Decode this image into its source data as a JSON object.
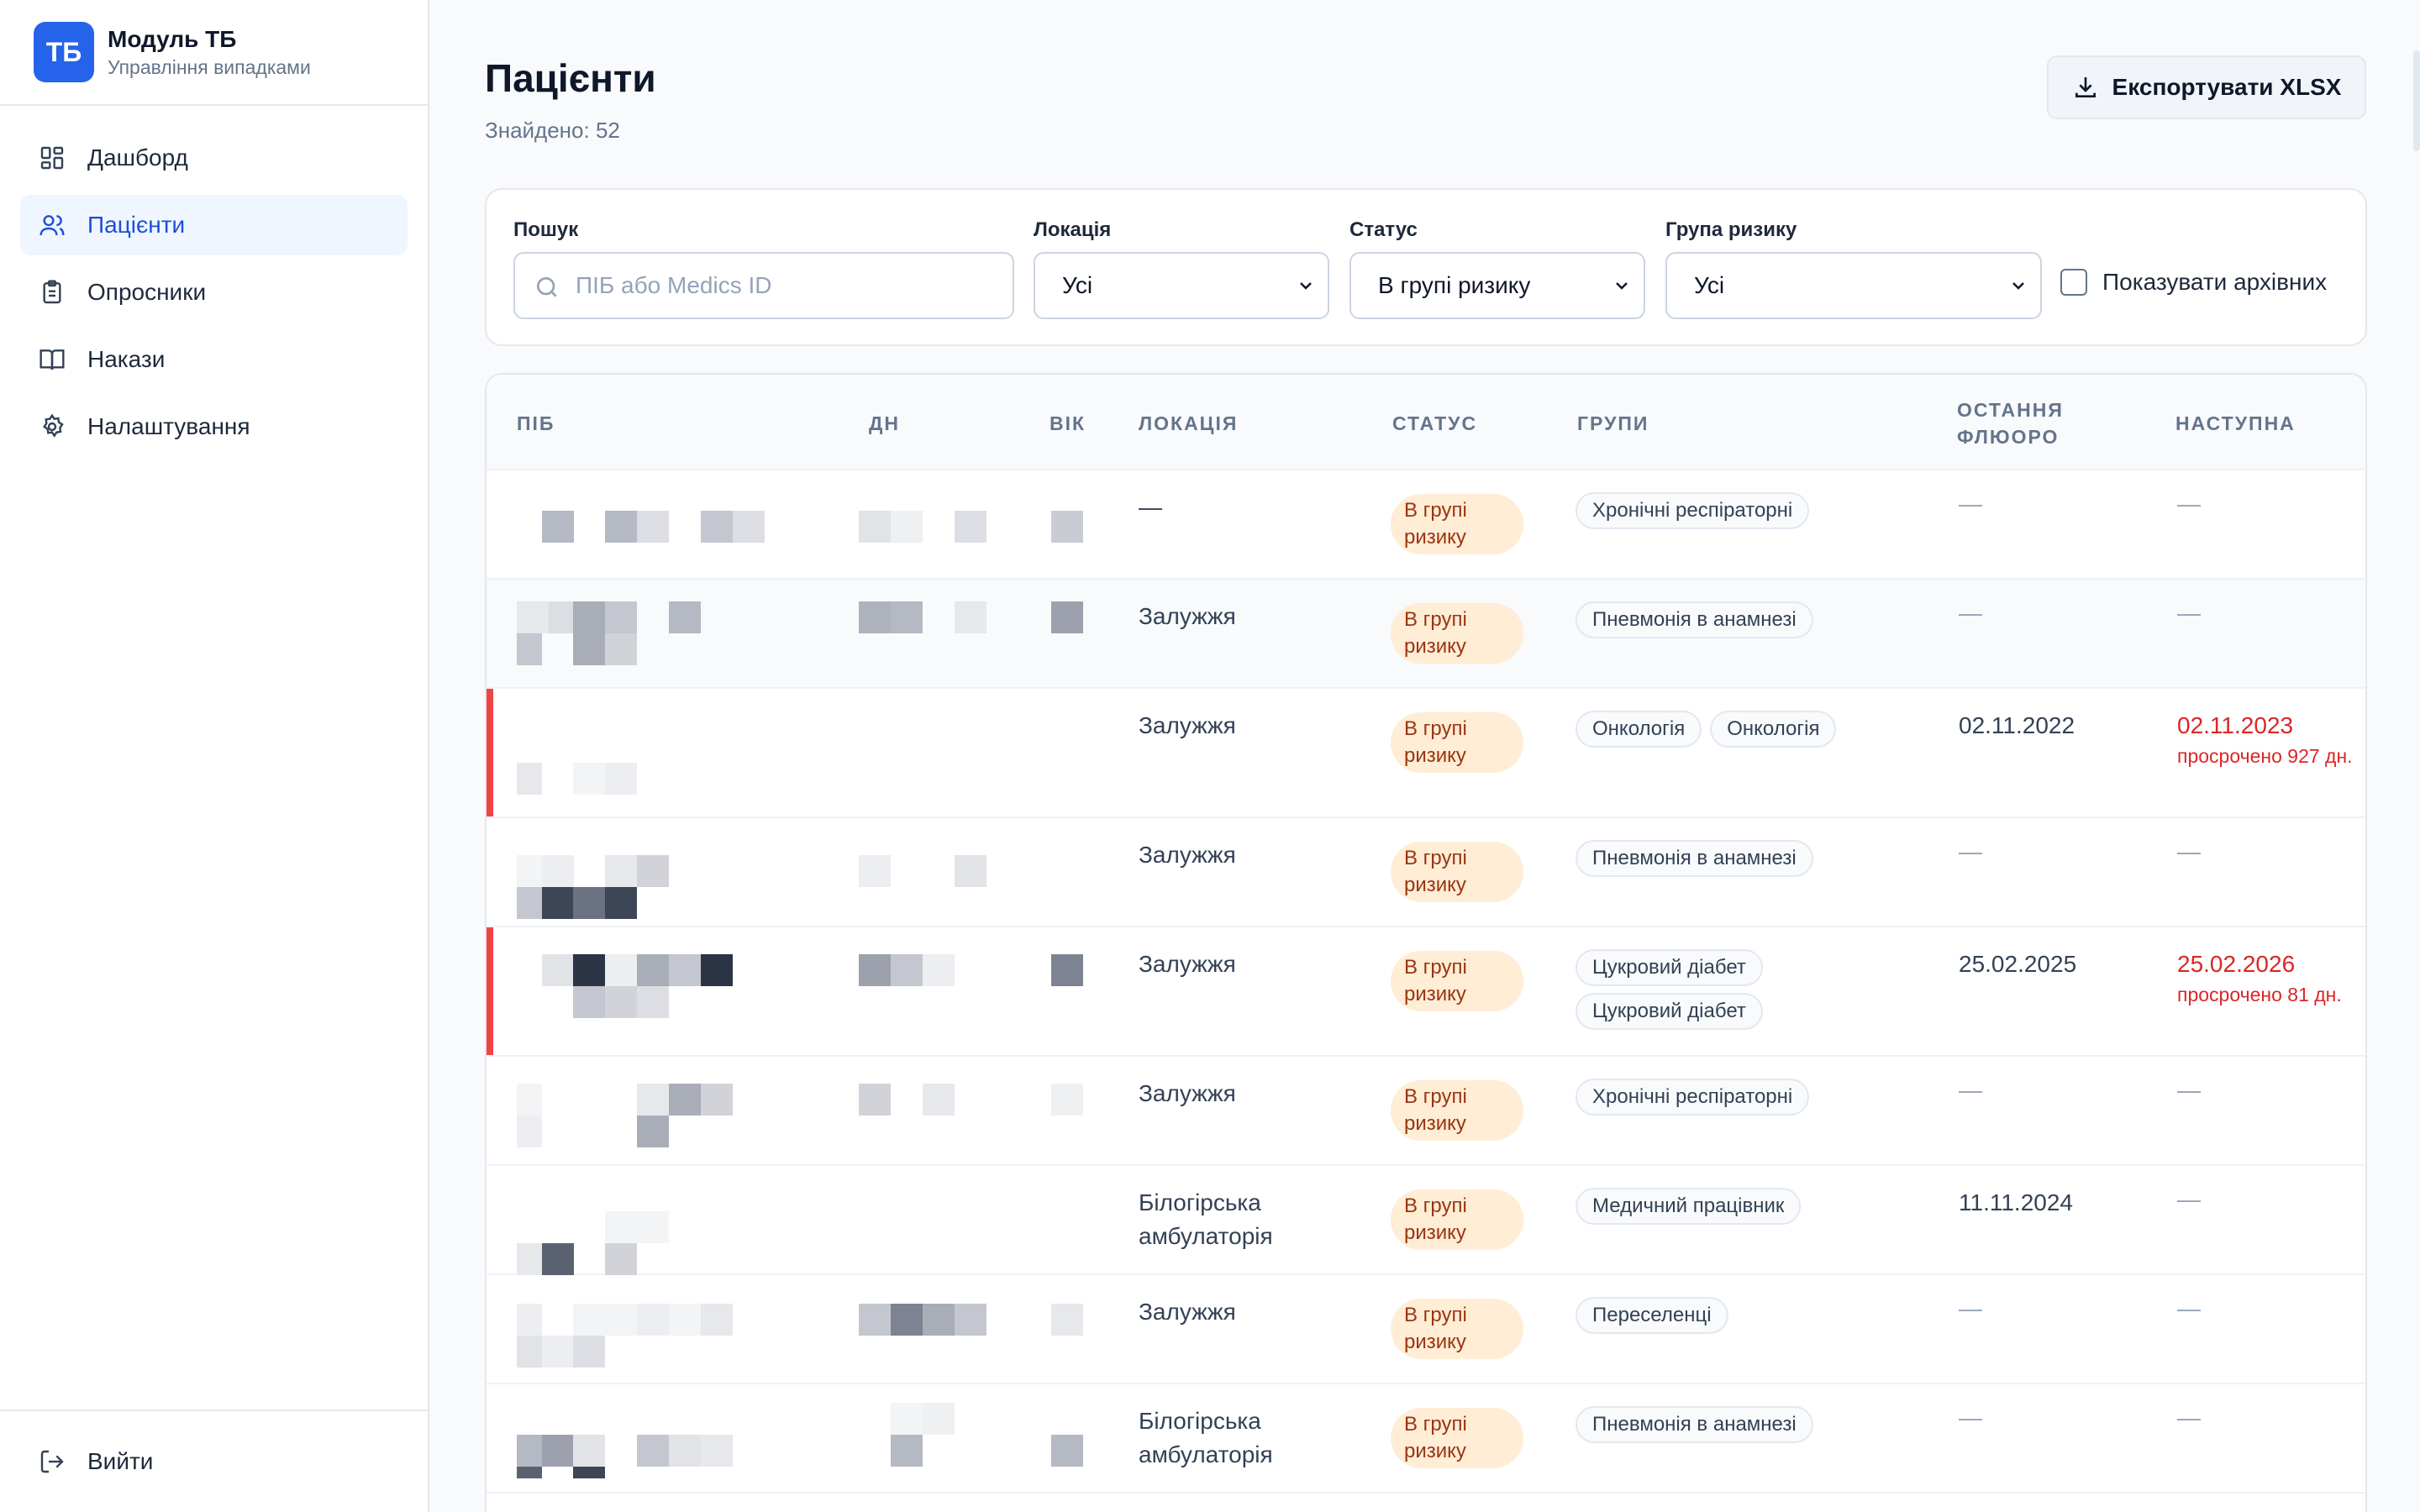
{
  "brand": {
    "logo": "ТБ",
    "title": "Модуль ТБ",
    "subtitle": "Управління випадками"
  },
  "nav": [
    {
      "label": "Дашборд",
      "icon": "dashboard-icon",
      "active": false
    },
    {
      "label": "Пацієнти",
      "icon": "users-icon",
      "active": true
    },
    {
      "label": "Опросники",
      "icon": "clipboard-icon",
      "active": false
    },
    {
      "label": "Накази",
      "icon": "book-icon",
      "active": false
    },
    {
      "label": "Налаштування",
      "icon": "gear-icon",
      "active": false
    }
  ],
  "logout": {
    "label": "Вийти",
    "icon": "logout-icon"
  },
  "page": {
    "title": "Пацієнти",
    "found": "Знайдено: 52",
    "export_label": "Експортувати XLSX"
  },
  "filters": {
    "search_label": "Пошук",
    "search_placeholder": "ПІБ або Medics ID",
    "location_label": "Локація",
    "location_value": "Усі",
    "status_label": "Статус",
    "status_value": "В групі ризику",
    "risk_label": "Група ризику",
    "risk_value": "Усі",
    "archive_label": "Показувати архівних",
    "archive_checked": false
  },
  "table": {
    "headers": {
      "name": "ПІБ",
      "dob": "ДН",
      "age": "ВІК",
      "location": "ЛОКАЦІЯ",
      "status": "СТАТУС",
      "groups": "ГРУПИ",
      "last_xray_1": "ОСТАННЯ",
      "last_xray_2": "ФЛЮОРО",
      "next": "НАСТУПНА"
    },
    "status_line1": "В групі",
    "status_line2": "ризику",
    "dash": "—",
    "rows": [
      {
        "location": "—",
        "groups": [
          "Хронічні респіраторні"
        ],
        "last": "—",
        "next": "—",
        "next_overdue": ""
      },
      {
        "location": "Залужжя",
        "groups": [
          "Пневмонія в анамнезі"
        ],
        "last": "—",
        "next": "—",
        "next_overdue": ""
      },
      {
        "location": "Залужжя",
        "groups": [
          "Онкологія",
          "Онкологія"
        ],
        "last": "02.11.2022",
        "next": "02.11.2023",
        "next_overdue": "просрочено 927 дн."
      },
      {
        "location": "Залужжя",
        "groups": [
          "Пневмонія в анамнезі"
        ],
        "last": "—",
        "next": "—",
        "next_overdue": ""
      },
      {
        "location": "Залужжя",
        "groups": [
          "Цукровий діабет",
          "Цукровий діабет"
        ],
        "last": "25.02.2025",
        "next": "25.02.2026",
        "next_overdue": "просрочено 81 дн."
      },
      {
        "location": "Залужжя",
        "groups": [
          "Хронічні респіраторні"
        ],
        "last": "—",
        "next": "—",
        "next_overdue": ""
      },
      {
        "location": "Білогірська амбулаторія",
        "groups": [
          "Медичний працівник"
        ],
        "last": "11.11.2024",
        "next": "—",
        "next_overdue": ""
      },
      {
        "location": "Залужжя",
        "groups": [
          "Переселенці"
        ],
        "last": "—",
        "next": "—",
        "next_overdue": ""
      },
      {
        "location": "Білогірська амбулаторія",
        "groups": [
          "Пневмонія в анамнезі"
        ],
        "last": "—",
        "next": "—",
        "next_overdue": ""
      }
    ]
  },
  "colors": {
    "accent": "#2563eb",
    "badge_bg": "#ffedd5",
    "badge_text": "#9a3412",
    "overdue": "#dc2626"
  }
}
